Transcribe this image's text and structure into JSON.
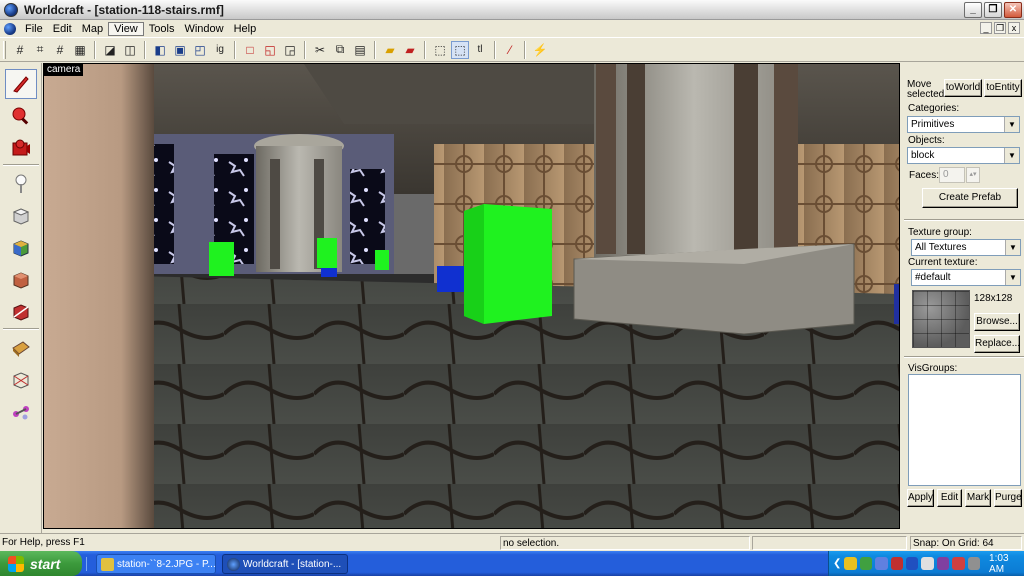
{
  "window": {
    "title": "Worldcraft - [station-118-stairs.rmf]"
  },
  "menu": {
    "items": [
      "File",
      "Edit",
      "Map",
      "View",
      "Tools",
      "Window",
      "Help"
    ],
    "active_index": 3
  },
  "toolbar": {
    "buttons": [
      {
        "icon": "grid-icon"
      },
      {
        "icon": "grid-snap-icon"
      },
      {
        "icon": "grid-small-icon"
      },
      {
        "icon": "grid-large-icon"
      },
      {
        "icon": "load-window-state-icon"
      },
      {
        "icon": "save-window-state-icon"
      },
      {
        "icon": "carve-icon"
      },
      {
        "icon": "group-icon"
      },
      {
        "icon": "ungroup-icon"
      },
      {
        "icon": "ignore-grouping-icon",
        "text": "ig"
      },
      {
        "icon": "hide-selected-icon"
      },
      {
        "icon": "hide-unselected-icon"
      },
      {
        "icon": "show-hidden-icon"
      },
      {
        "icon": "cut-icon"
      },
      {
        "icon": "copy-icon"
      },
      {
        "icon": "paste-icon"
      },
      {
        "icon": "texture-lock-icon"
      },
      {
        "icon": "texture-lock-scale-icon"
      },
      {
        "icon": "selection-box-icon"
      },
      {
        "icon": "selection-handles-icon"
      },
      {
        "icon": "tie-to-entity-icon",
        "text": "tl"
      },
      {
        "icon": "run-map-icon"
      },
      {
        "icon": "entity-report-icon"
      }
    ]
  },
  "tools": [
    {
      "name": "selection-tool",
      "icon": "pointer-icon",
      "color": "#d42a2a"
    },
    {
      "name": "magnify-tool",
      "icon": "magnify-icon",
      "color": "#d42a2a"
    },
    {
      "name": "camera-tool",
      "icon": "camera-icon",
      "color": "#c41a1a"
    },
    {
      "name": "entity-tool",
      "icon": "entity-icon",
      "color": "#ffffff"
    },
    {
      "name": "block-tool",
      "icon": "block-icon",
      "color": "#bfbfbf"
    },
    {
      "name": "apply-texture-tool",
      "icon": "apply-texture-icon",
      "color": "#4a9a3a"
    },
    {
      "name": "apply-decal-tool",
      "icon": "decal-icon",
      "color": "#c06040"
    },
    {
      "name": "clip-tool",
      "icon": "clip-icon",
      "color": "#c03030"
    },
    {
      "name": "vertex-tool",
      "icon": "vertex-icon",
      "color": "#d9a040"
    },
    {
      "name": "path-tool",
      "icon": "path-icon",
      "color": "#a0a0a0"
    },
    {
      "name": "overlay-tool",
      "icon": "overlay-icon",
      "color": "#c040c0"
    }
  ],
  "viewport": {
    "label": "camera"
  },
  "panel": {
    "move_selected_label": "Move selected:",
    "to_world_label": "toWorld",
    "to_entity_label": "toEntity",
    "categories_label": "Categories:",
    "categories_value": "Primitives",
    "objects_label": "Objects:",
    "objects_value": "block",
    "faces_label": "Faces:",
    "faces_value": "0",
    "create_prefab_label": "Create Prefab",
    "texture_group_label": "Texture group:",
    "texture_group_value": "All Textures",
    "current_texture_label": "Current texture:",
    "current_texture_value": "#default",
    "texture_size": "128x128",
    "browse_label": "Browse...",
    "replace_label": "Replace...",
    "visgroups_label": "VisGroups:",
    "apply_label": "Apply",
    "edit_label": "Edit",
    "mark_label": "Mark",
    "purge_label": "Purge"
  },
  "status": {
    "help": "For Help, press F1",
    "selection": "no selection.",
    "snap": "Snap: On Grid: 64"
  },
  "taskbar": {
    "start_label": "start",
    "tasks": [
      {
        "label": "station-``8-2.JPG - P...",
        "active": false
      },
      {
        "label": "Worldcraft - [station-...",
        "active": true
      }
    ],
    "clock": "1:03 AM"
  },
  "colors": {
    "brush_green": "#1ff21f",
    "entity_blue": "#1030d0"
  }
}
